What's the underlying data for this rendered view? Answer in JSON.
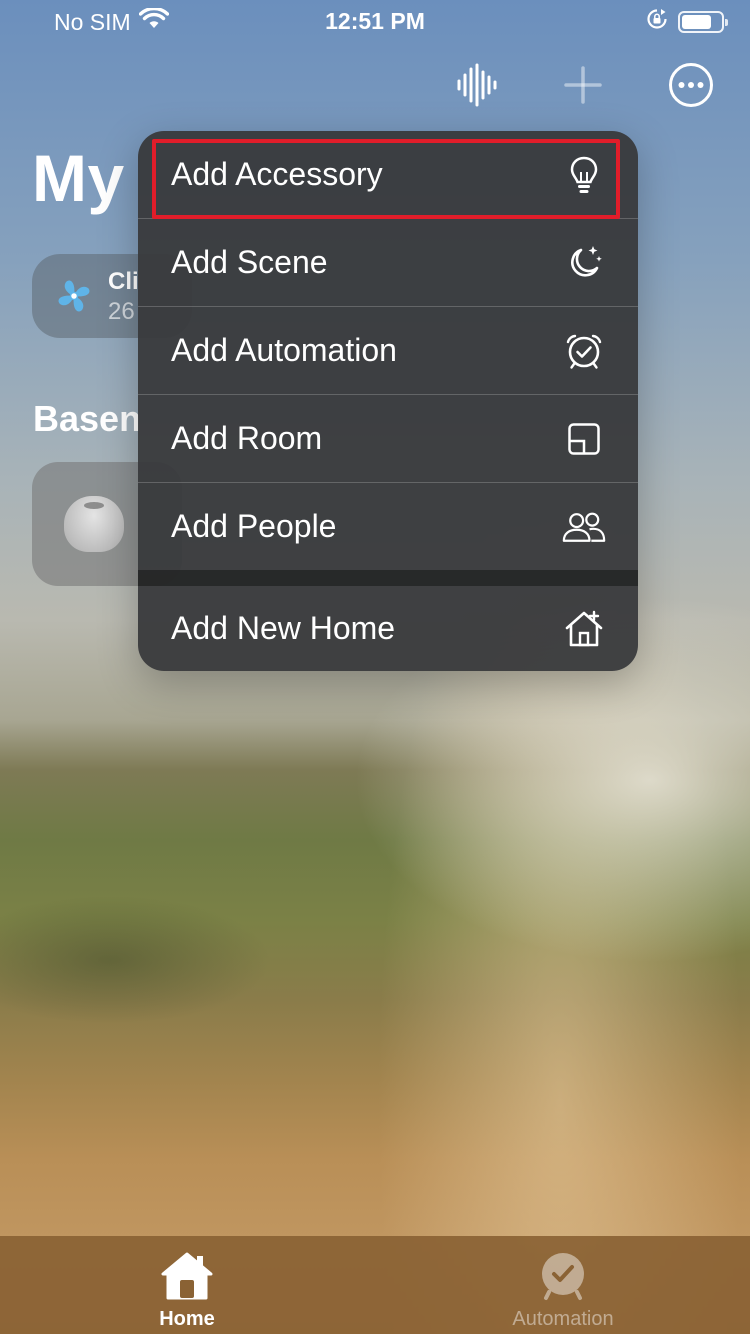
{
  "status_bar": {
    "carrier": "No SIM",
    "time": "12:51 PM",
    "battery_level": 0.75
  },
  "toolbar": {
    "icons": [
      "voice-waveform-icon",
      "plus-icon",
      "more-ellipsis-icon"
    ]
  },
  "home": {
    "title": "My",
    "climate_tile": {
      "name": "Cli",
      "value": "26",
      "icon": "fan-icon"
    },
    "section_title": "Basen",
    "accessory_icon": "homepod-mini-icon"
  },
  "menu": {
    "items": [
      {
        "label": "Add Accessory",
        "icon": "lightbulb-icon"
      },
      {
        "label": "Add Scene",
        "icon": "moon-stars-icon"
      },
      {
        "label": "Add Automation",
        "icon": "alarm-clock-icon"
      },
      {
        "label": "Add Room",
        "icon": "room-icon"
      },
      {
        "label": "Add People",
        "icon": "people-icon"
      },
      {
        "label": "Add New Home",
        "icon": "house-plus-icon"
      }
    ],
    "highlight_color": "#e11d2a"
  },
  "tab_bar": {
    "tabs": [
      {
        "label": "Home",
        "icon": "home-icon",
        "selected": true
      },
      {
        "label": "Automation",
        "icon": "clock-check-icon",
        "selected": false
      }
    ]
  }
}
